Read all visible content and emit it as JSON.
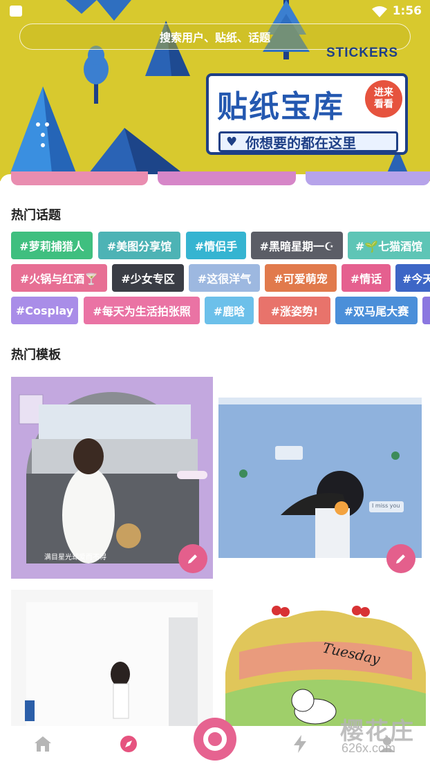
{
  "status_bar": {
    "time": "1:56"
  },
  "search": {
    "placeholder": "搜索用户、贴纸、话题"
  },
  "banner": {
    "tag": "STICKERS",
    "title": "贴纸宝库",
    "badge_line1": "进来",
    "badge_line2": "看看",
    "subtitle": "你想要的都在这里"
  },
  "hot_topics": {
    "title": "热门话题",
    "rows": [
      [
        {
          "label": "#萝莉捕猎人",
          "color": "#3fbf7f"
        },
        {
          "label": "#美图分享馆",
          "color": "#4db3b5"
        },
        {
          "label": "#情侣手",
          "color": "#35b4d1"
        },
        {
          "label": "#黑暗星期一☪",
          "color": "#5b5d66"
        },
        {
          "label": "#🌱七猫酒馆",
          "color": "#5ec5b6"
        }
      ],
      [
        {
          "label": "#火锅与红酒🍸",
          "color": "#e76f94"
        },
        {
          "label": "#少女专区",
          "color": "#3a3d45"
        },
        {
          "label": "#这很洋气",
          "color": "#9db8e0"
        },
        {
          "label": "#可爱萌宠",
          "color": "#e17a4c"
        },
        {
          "label": "#情话",
          "color": "#e5608f"
        },
        {
          "label": "#今天",
          "color": "#3d66c6"
        }
      ],
      [
        {
          "label": "#Cosplay",
          "color": "#a98de8"
        },
        {
          "label": "#每天为生活拍张照",
          "color": "#ea73a4"
        },
        {
          "label": "#鹿晗",
          "color": "#6cc0ea"
        },
        {
          "label": "#涨姿势!",
          "color": "#e8736b"
        },
        {
          "label": "#双马尾大赛",
          "color": "#4b8fd9"
        },
        {
          "label": "",
          "color": "#8b77e0"
        }
      ]
    ]
  },
  "hot_templates": {
    "title": "热门模板",
    "items": [
      {
        "caption": "满目星光却爱而不得",
        "bg": "#c3a8df"
      },
      {
        "caption": "I miss you",
        "bg": "#8fb2dd"
      },
      {
        "caption": "",
        "bg": "#f3f3f3"
      },
      {
        "caption": "Tuesday",
        "bg": "#ffffff"
      }
    ]
  },
  "watermark": {
    "main": "樱花庄",
    "sub": "626x.com"
  },
  "nav": {
    "items": [
      "home-icon",
      "discover-icon",
      "create-icon",
      "flash-icon",
      "profile-icon"
    ]
  }
}
